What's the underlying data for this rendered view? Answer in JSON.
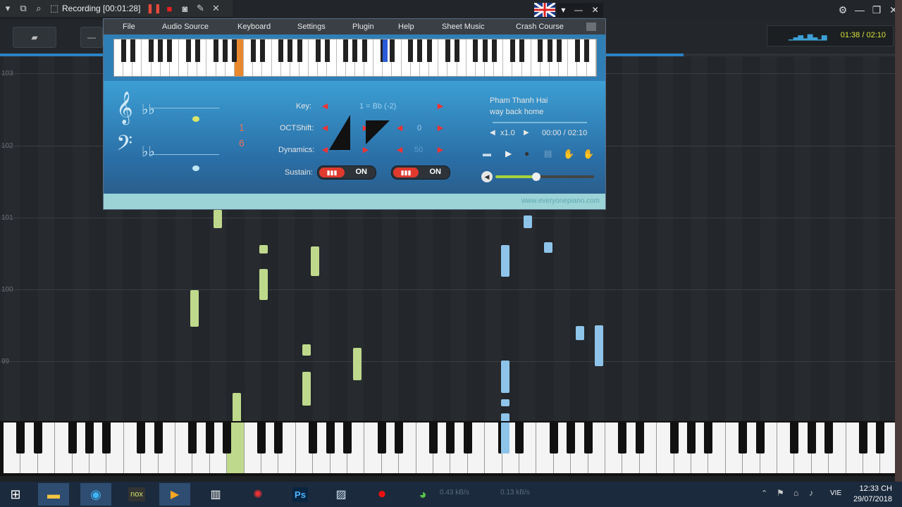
{
  "recorder": {
    "label": "Recording [00:01:28]"
  },
  "player": {
    "time": "01:38 / 02:10"
  },
  "measures": [
    "103",
    "102",
    "101",
    "100",
    "99"
  ],
  "piano_window": {
    "menu": [
      "File",
      "Audio Source",
      "Keyboard",
      "Settings",
      "Plugin",
      "Help",
      "Sheet Music",
      "Crash Course"
    ],
    "key_label": "Key:",
    "key_value": "1 = Bb (-2)",
    "oct_label": "OCTShift:",
    "oct_value_left": "0",
    "oct_value_right": "0",
    "dyn_label": "Dynamics:",
    "dyn_value_left": "50",
    "dyn_value_right": "50",
    "sustain_label": "Sustain:",
    "sustain_left": "ON",
    "sustain_right": "ON",
    "song_artist": "Pham Thanh Hai",
    "song_title": "way back home",
    "speed": "x1.0",
    "song_time": "00:00 / 02:10",
    "footer_url": "www.everyonepiano.com",
    "note_numbers": [
      "1",
      "6"
    ]
  },
  "taskbar": {
    "net_down": "0.43 kB/s",
    "net_up": "0.13 kB/s",
    "lang": "VIE",
    "time": "12:33 CH",
    "date": "29/07/2018"
  }
}
